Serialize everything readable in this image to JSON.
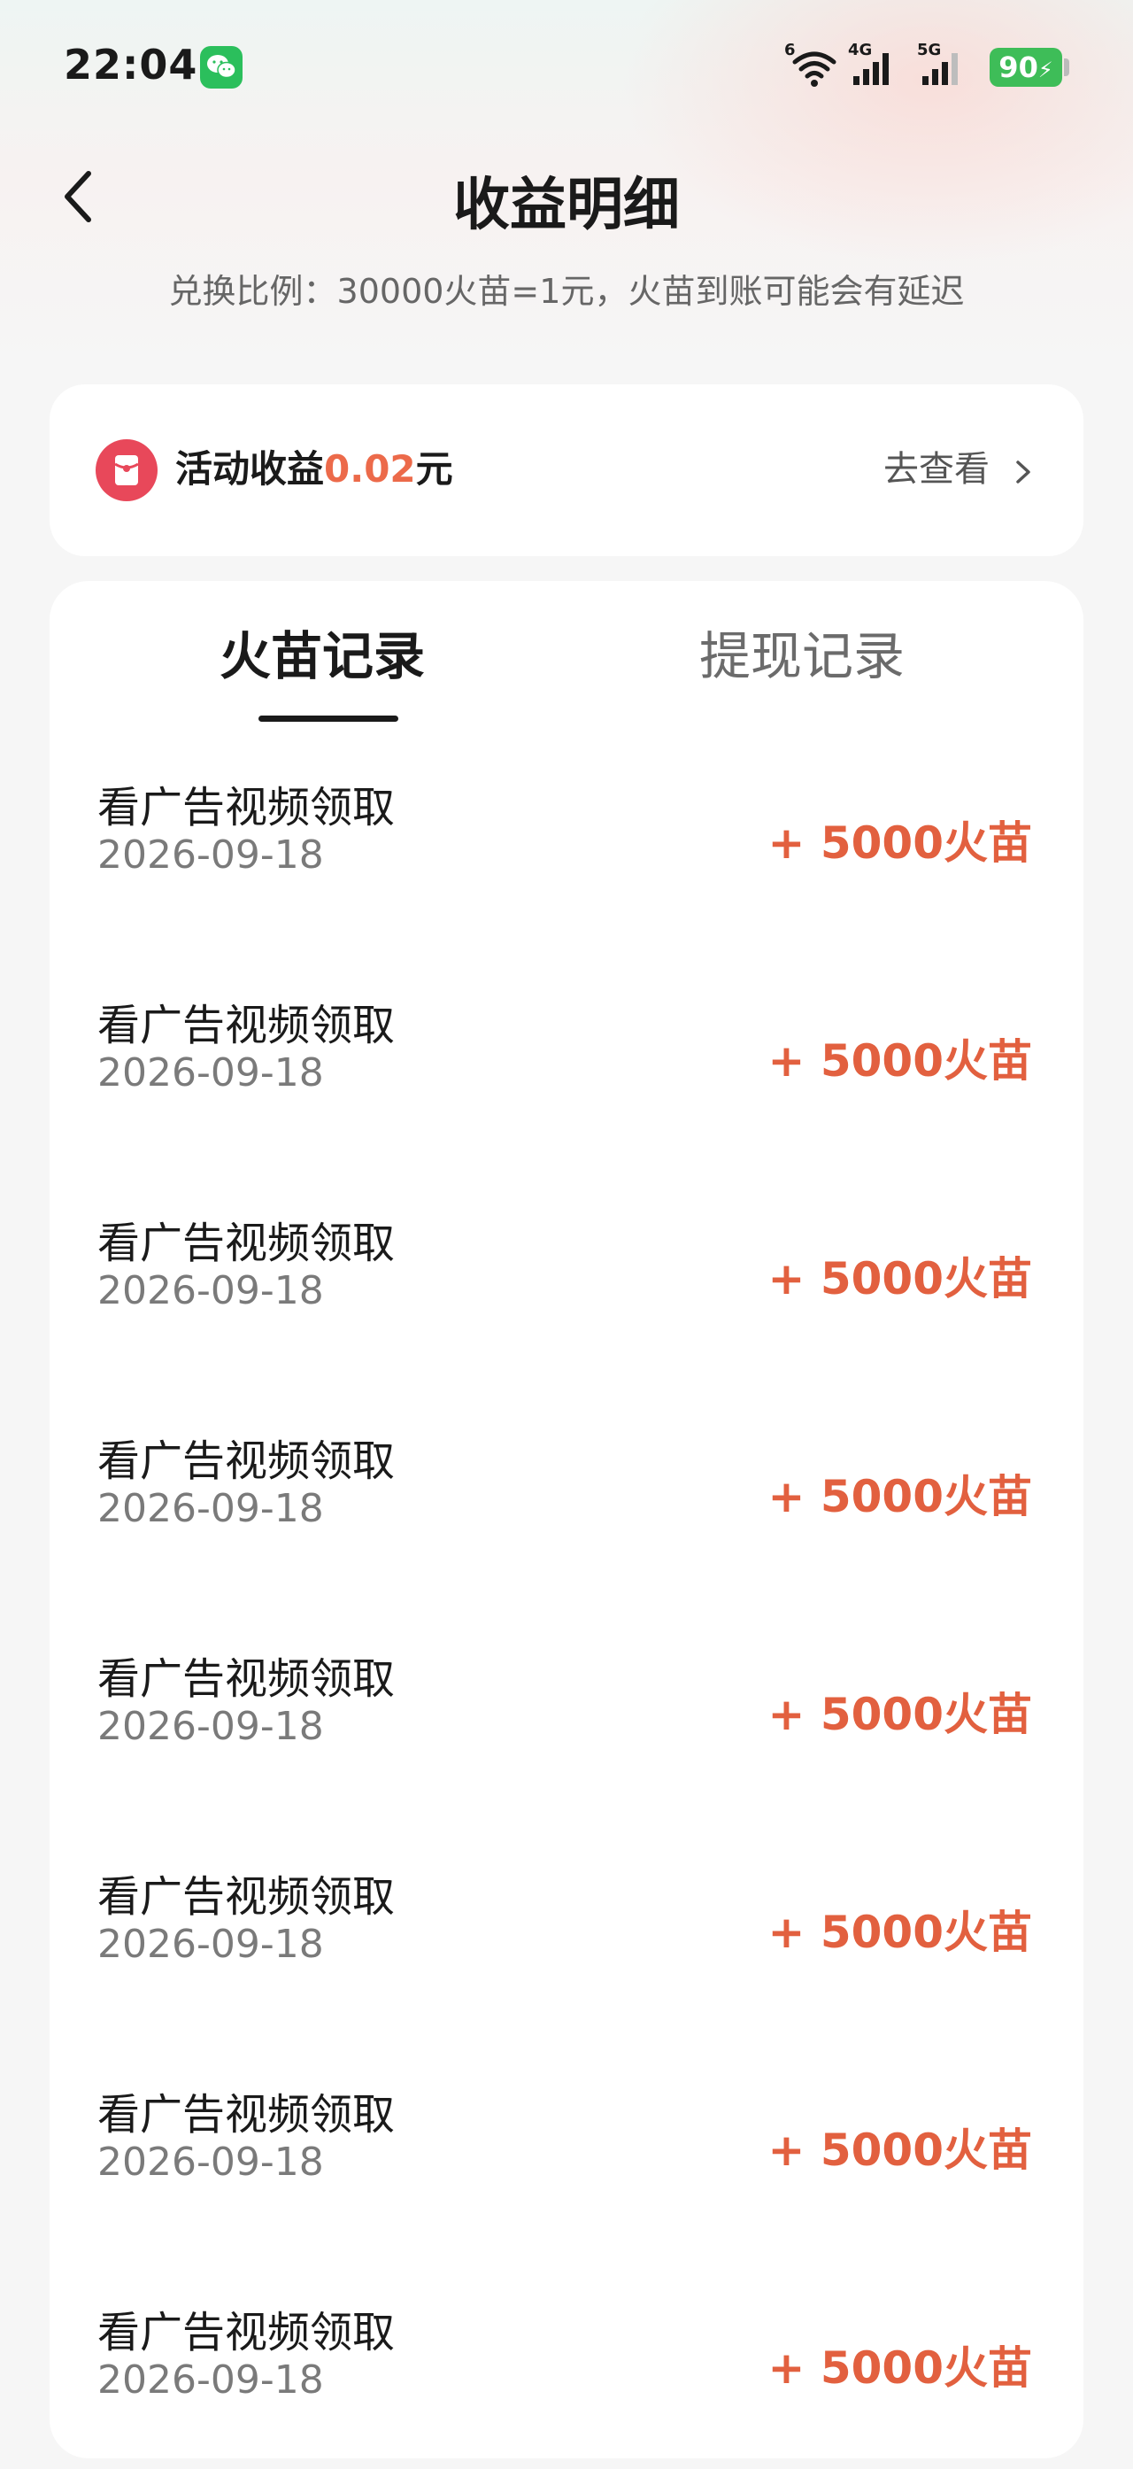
{
  "status_bar": {
    "time": "22:04",
    "wifi_label": "6",
    "net1_label": "4G",
    "net2_label": "5G",
    "battery": "90"
  },
  "header": {
    "title": "收益明细",
    "subtitle": "兑换比例：30000火苗=1元，火苗到账可能会有延迟"
  },
  "activity": {
    "label": "活动收益",
    "amount": "0.02",
    "unit": "元",
    "link": "去查看",
    "accent": "#ec6a4a"
  },
  "tabs": [
    {
      "label": "火苗记录",
      "active": true
    },
    {
      "label": "提现记录",
      "active": false
    }
  ],
  "records": [
    {
      "title": "看广告视频领取",
      "date": "2026-09-18",
      "amount": "+ 5000火苗"
    },
    {
      "title": "看广告视频领取",
      "date": "2026-09-18",
      "amount": "+ 5000火苗"
    },
    {
      "title": "看广告视频领取",
      "date": "2026-09-18",
      "amount": "+ 5000火苗"
    },
    {
      "title": "看广告视频领取",
      "date": "2026-09-18",
      "amount": "+ 5000火苗"
    },
    {
      "title": "看广告视频领取",
      "date": "2026-09-18",
      "amount": "+ 5000火苗"
    },
    {
      "title": "看广告视频领取",
      "date": "2026-09-18",
      "amount": "+ 5000火苗"
    },
    {
      "title": "看广告视频领取",
      "date": "2026-09-18",
      "amount": "+ 5000火苗"
    },
    {
      "title": "看广告视频领取",
      "date": "2026-09-18",
      "amount": "+ 5000火苗"
    }
  ],
  "colors": {
    "amount": "#e2603f",
    "redpacket": "#e8485a",
    "battery": "#3ebd58",
    "wechat": "#2bbf5c"
  },
  "icons": [
    "wechat-icon",
    "wifi-icon",
    "signal-icon",
    "battery-icon",
    "back-arrow-icon",
    "red-packet-icon",
    "chevron-right-icon"
  ]
}
